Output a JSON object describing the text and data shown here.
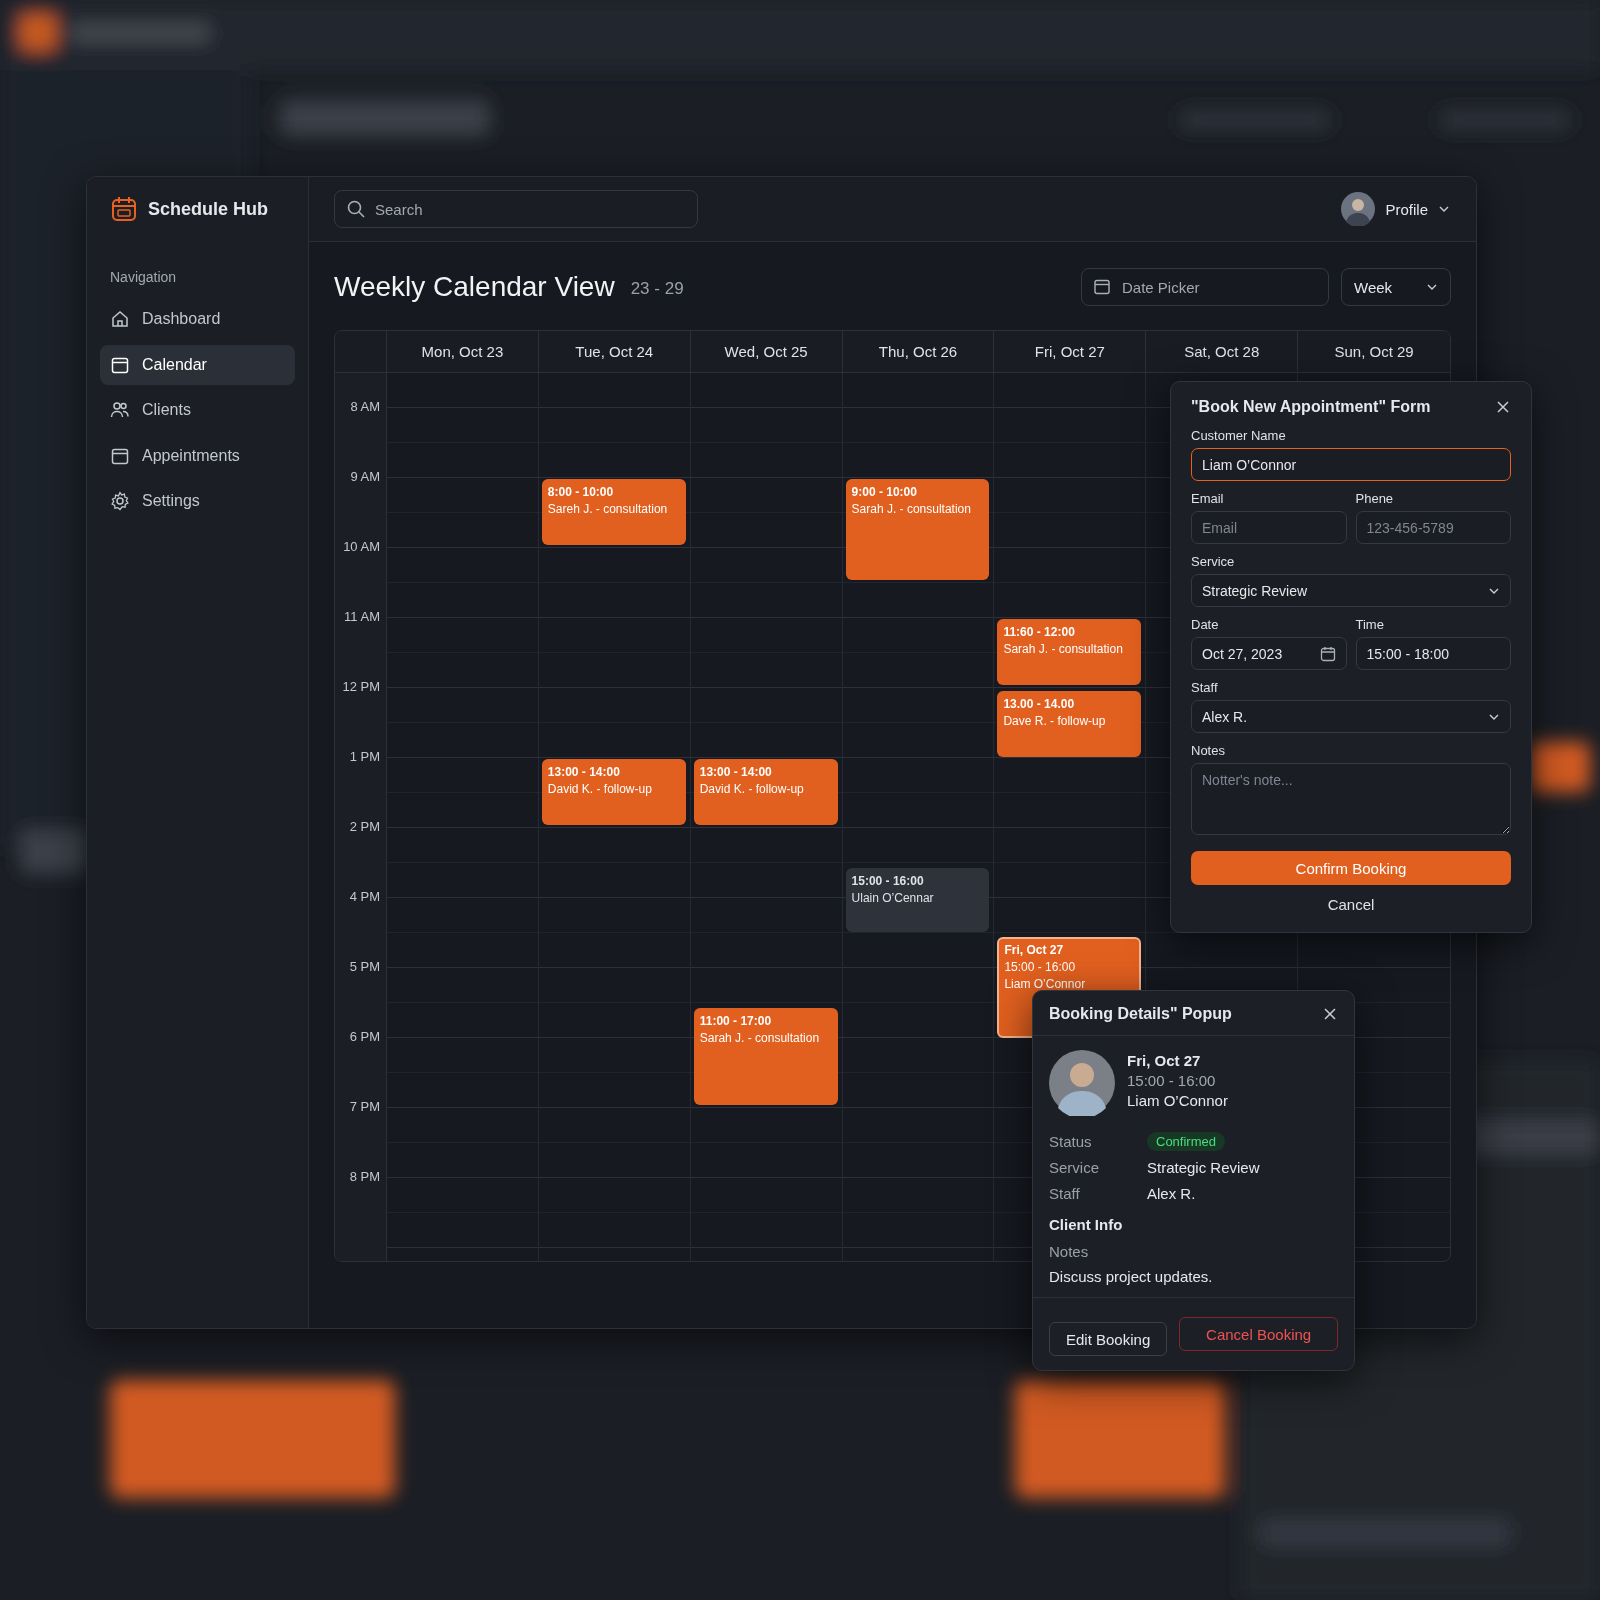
{
  "app": {
    "name": "Schedule Hub"
  },
  "search": {
    "placeholder": "Search"
  },
  "profile": {
    "label": "Profile"
  },
  "sidebar": {
    "heading": "Navigation",
    "items": [
      {
        "label": "Dashboard",
        "selected": false
      },
      {
        "label": "Calendar",
        "selected": true
      },
      {
        "label": "Clients",
        "selected": false
      },
      {
        "label": "Appeintments",
        "selected": false
      },
      {
        "label": "Settings",
        "selected": false
      }
    ]
  },
  "page": {
    "title": "Weekly Calendar View",
    "range": "23 - 29",
    "date_picker": {
      "placeholder": "Date Picker"
    },
    "view_select": {
      "value": "Week"
    }
  },
  "calendar": {
    "times": [
      "8 AM",
      "9 AM",
      "10 AM",
      "11 AM",
      "12 PM",
      "1 PM",
      "2 PM",
      "4 PM",
      "5 PM",
      "6 PM",
      "7 PM",
      "8 PM"
    ],
    "days": [
      {
        "label": "Mon, Oct 23"
      },
      {
        "label": "Tue, Oct 24",
        "events": [
          {
            "kind": "booked",
            "selected": false,
            "lines": [
              "8:00 - 10:00",
              "Sareh J. - consultation"
            ]
          },
          {
            "kind": "booked",
            "selected": false,
            "lines": [
              "13:00 - 14:00",
              "David K. - follow-up"
            ]
          }
        ]
      },
      {
        "label": "Wed, Oct 25",
        "events": [
          {
            "kind": "booked",
            "selected": false,
            "lines": [
              "13:00 - 14:00",
              "David K. - follow-up"
            ]
          },
          {
            "kind": "booked",
            "selected": false,
            "lines": [
              "11:00 - 17:00",
              "Sarah J. - consultation"
            ]
          }
        ]
      },
      {
        "label": "Thu, Oct 26",
        "events": [
          {
            "kind": "booked",
            "selected": false,
            "lines": [
              "9:00 - 10:00",
              "Sarah J. - consultation"
            ]
          },
          {
            "kind": "tentative",
            "selected": false,
            "lines": [
              "15:00 - 16:00",
              "Ulain O’Cennar"
            ]
          }
        ]
      },
      {
        "label": "Fri, Oct 27",
        "events": [
          {
            "kind": "booked",
            "selected": false,
            "lines": [
              "11:60 - 12:00",
              "Sarah J. - consultation"
            ]
          },
          {
            "kind": "booked",
            "selected": false,
            "lines": [
              "13.00 - 14.00",
              "Dave R. - follow-up"
            ]
          },
          {
            "kind": "booked",
            "selected": true,
            "lines": [
              "Fri, Oct 27",
              "15:00 - 16:00",
              "Liam O’Connor"
            ]
          }
        ]
      },
      {
        "label": "Sat, Oct 28"
      },
      {
        "label": "Sun, Oct 29"
      }
    ]
  },
  "booking_form": {
    "title": "\"Book New Appointment\" Form",
    "fields": [
      {
        "kind": "text",
        "label": "Customer Name",
        "value": "Liam O’Connor",
        "focused": true
      },
      {
        "kind": "text",
        "label": "Email",
        "placeholder": "Email",
        "focused": false
      },
      {
        "kind": "text",
        "label": "Phene",
        "placeholder": "123-456-5789",
        "focused": false
      },
      {
        "kind": "select",
        "label": "Service",
        "value": "Strategic Review"
      },
      {
        "kind": "date",
        "label": "Date",
        "value": "Oct 27, 2023"
      },
      {
        "kind": "text",
        "label": "Time",
        "value": "15:00 - 18:00",
        "focused": false
      },
      {
        "kind": "select",
        "label": "Staff",
        "value": "Alex R."
      },
      {
        "kind": "textarea",
        "label": "Notes",
        "placeholder": "Notter's note..."
      }
    ],
    "confirm": "Confirm Booking",
    "cancel": "Cancel"
  },
  "booking_popup": {
    "title": "Booking Details\" Popup",
    "date": "Fri, Oct 27",
    "time": "15:00 - 16:00",
    "client": "Liam O’Connor",
    "details": [
      {
        "label": "Status",
        "value": "Confirmed",
        "kind": "badge"
      },
      {
        "label": "Service",
        "value": "Strategic Review",
        "kind": "text"
      },
      {
        "label": "Staff",
        "value": "Alex R.",
        "kind": "text"
      }
    ],
    "section": "Client Info",
    "notes_label": "Notes",
    "notes": "Discuss project updates.",
    "buttons": [
      {
        "label": "Edit Booking",
        "kind": "secondary"
      },
      {
        "label": "Cancel Booking",
        "kind": "danger"
      }
    ]
  }
}
